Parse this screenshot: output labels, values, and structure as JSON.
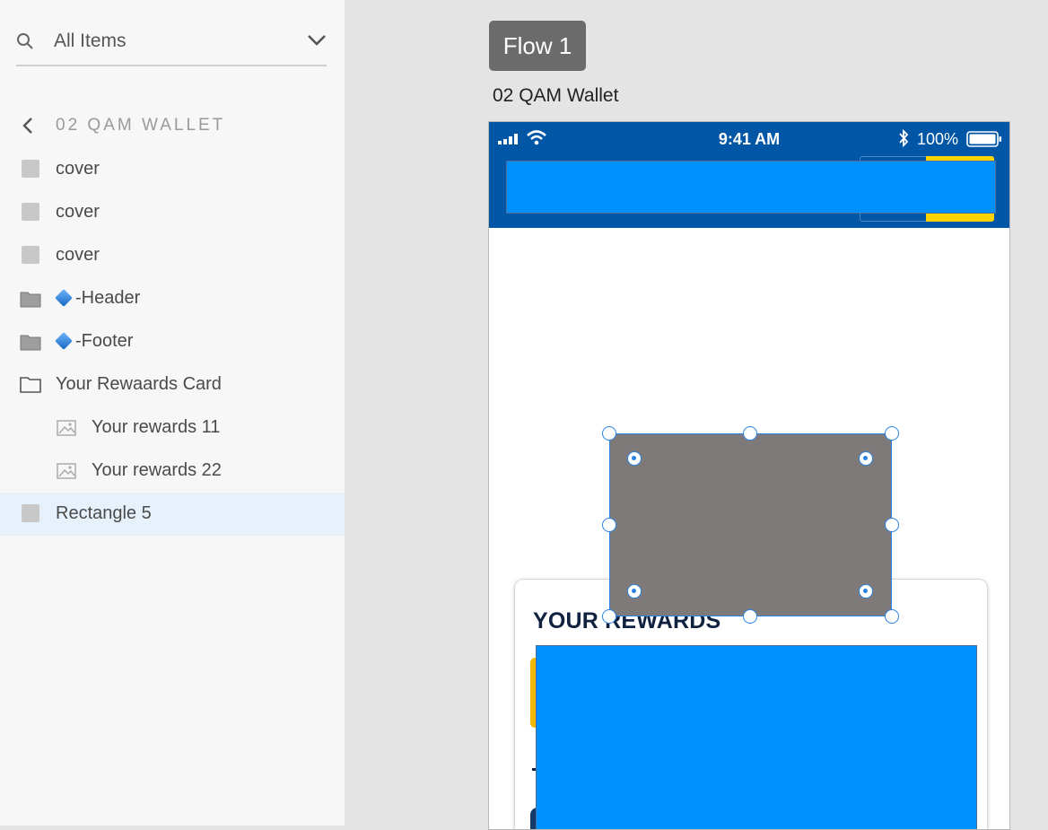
{
  "layers_panel": {
    "filter_label": "All Items",
    "breadcrumb": "02 QAM WALLET",
    "items": [
      {
        "label": "cover",
        "icon": "rectangle-icon"
      },
      {
        "label": "cover",
        "icon": "rectangle-icon"
      },
      {
        "label": "cover",
        "icon": "rectangle-icon"
      },
      {
        "label": "-Header",
        "icon": "folder-filled-icon",
        "symbol": "component-diamond-icon"
      },
      {
        "label": "-Footer",
        "icon": "folder-filled-icon",
        "symbol": "component-diamond-icon"
      },
      {
        "label": "Your Rewaards Card",
        "icon": "folder-outline-icon"
      },
      {
        "label": "Your rewards 11",
        "icon": "image-icon"
      },
      {
        "label": "Your rewards 22",
        "icon": "image-icon"
      },
      {
        "label": "Rectangle 5",
        "icon": "rectangle-icon",
        "selected": true
      }
    ]
  },
  "canvas": {
    "flow_label": "Flow 1",
    "artboard_title": "02 QAM Wallet",
    "status_bar": {
      "time": "9:41 AM",
      "battery": "100%"
    },
    "rewards_card_title": "YOUR REWARDS"
  },
  "colors": {
    "header_bg": "#0256a6",
    "placeholder_blue": "#0091ff",
    "accent_yellow": "#ffd400",
    "selection": "#2a82e4",
    "rectangle_fill": "#7e7a7a"
  }
}
